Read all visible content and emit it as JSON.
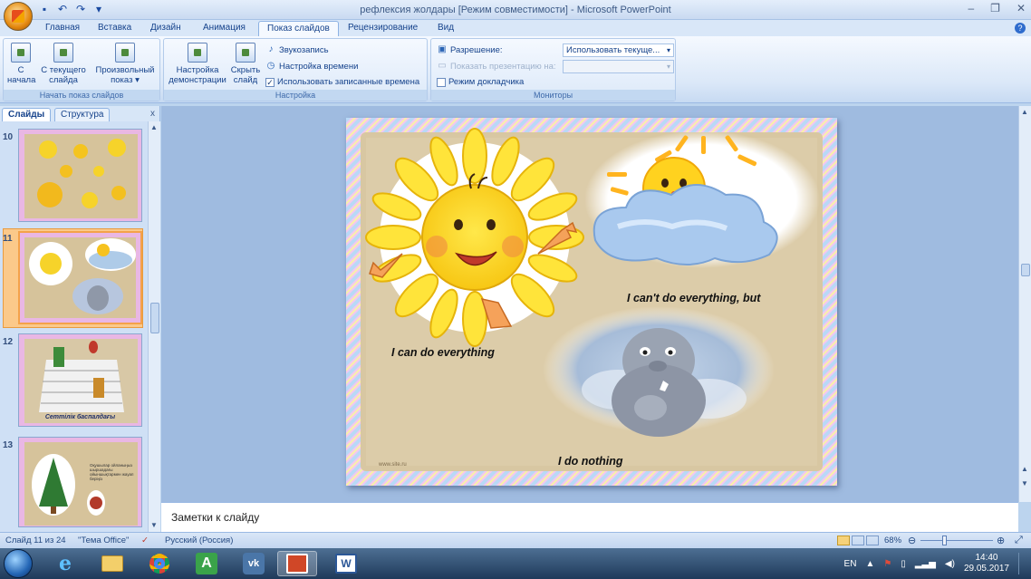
{
  "window": {
    "title": "рефлексия жолдары [Режим совместимости] - Microsoft PowerPoint"
  },
  "tabs": [
    {
      "label": "Главная"
    },
    {
      "label": "Вставка"
    },
    {
      "label": "Дизайн"
    },
    {
      "label": "Анимация"
    },
    {
      "label": "Показ слайдов",
      "active": true
    },
    {
      "label": "Рецензирование"
    },
    {
      "label": "Вид"
    }
  ],
  "ribbon": {
    "start_group": {
      "label": "Начать показ слайдов",
      "from_start_1": "С",
      "from_start_2": "начала",
      "from_current_1": "С текущего",
      "from_current_2": "слайда",
      "custom_1": "Произвольный",
      "custom_2": "показ ▾"
    },
    "setup_group": {
      "label": "Настройка",
      "setup_1": "Настройка",
      "setup_2": "демонстрации",
      "hide_1": "Скрыть",
      "hide_2": "слайд",
      "record": "Звукозапись",
      "rehearse": "Настройка времени",
      "use_timings": "Использовать записанные времена"
    },
    "monitors_group": {
      "label": "Мониторы",
      "resolution_label": "Разрешение:",
      "resolution_value": "Использовать текуще...",
      "show_on_label": "Показать презентацию на:",
      "show_on_value": "",
      "presenter_view": "Режим докладчика"
    }
  },
  "left_panel": {
    "tab_slides": "Слайды",
    "tab_outline": "Структура",
    "close": "x",
    "thumbnails": [
      {
        "number": "10",
        "caption": ""
      },
      {
        "number": "11",
        "caption": "",
        "selected": true
      },
      {
        "number": "12",
        "caption": "Сеттілік баспалдағы"
      },
      {
        "number": "13",
        "caption": "Оқушылар ойланыңыз шыршадағы ойыншықтармен жауап беріңіз"
      }
    ]
  },
  "slide": {
    "caption_1": "I can do everything",
    "caption_2": "I can't do everything, but",
    "caption_3": "I do nothing",
    "watermark": "www.site.ru"
  },
  "notes": {
    "placeholder": "Заметки к слайду"
  },
  "statusbar": {
    "slide_counter": "Слайд 11 из 24",
    "theme": "\"Тема Office\"",
    "language": "Русский (Россия)",
    "zoom": "68%"
  },
  "taskbar": {
    "language": "EN",
    "time": "14:40",
    "date": "29.05.2017",
    "apps": [
      {
        "name": "internet-explorer"
      },
      {
        "name": "file-explorer"
      },
      {
        "name": "chrome"
      },
      {
        "name": "app-a"
      },
      {
        "name": "vk"
      },
      {
        "name": "powerpoint",
        "active": true
      },
      {
        "name": "word"
      }
    ]
  },
  "colors": {
    "accent": "#15428b",
    "ribbon": "#dbe8f8",
    "slide_area": "#9fbbe0",
    "selection": "#f4a24a"
  }
}
